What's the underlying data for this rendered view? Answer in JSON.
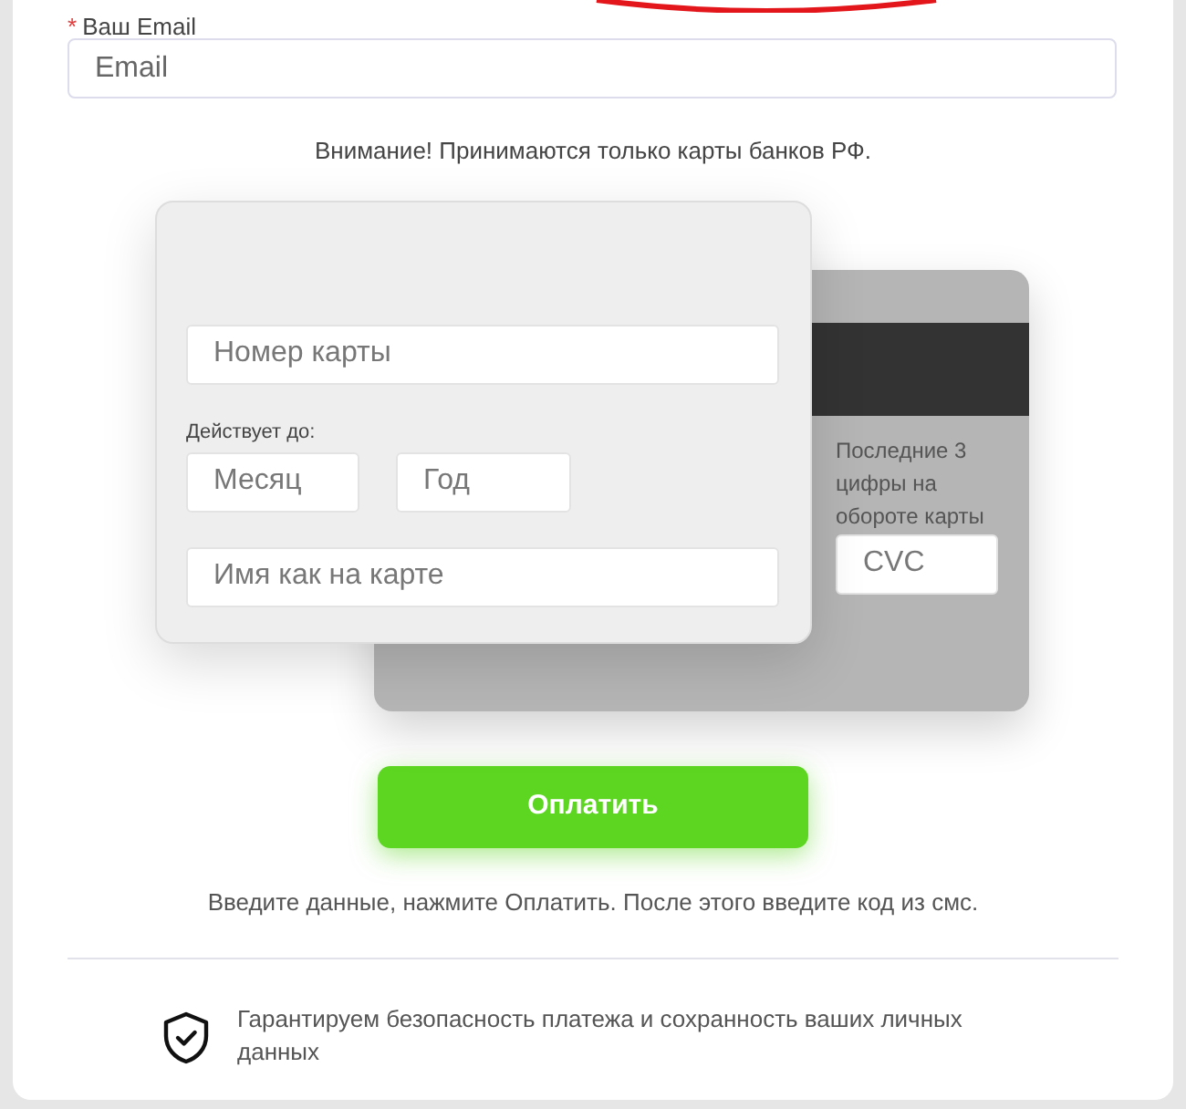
{
  "email_field": {
    "required_mark": "*",
    "label": "Ваш Email",
    "placeholder": "Email"
  },
  "notice": "Внимание! Принимаются только карты банков РФ.",
  "card_front": {
    "card_number_placeholder": "Номер карты",
    "expiry_label": "Действует до:",
    "month_placeholder": "Месяц",
    "year_placeholder": "Год",
    "name_placeholder": "Имя как на карте"
  },
  "card_back": {
    "cvc_hint": "Последние 3 цифры на обороте карты",
    "cvc_placeholder": "CVC"
  },
  "pay_button": "Оплатить",
  "instruction": "Введите данные, нажмите Оплатить. После этого введите код из смс.",
  "security_note": "Гарантируем безопасность платежа и сохранность ваших личных данных"
}
